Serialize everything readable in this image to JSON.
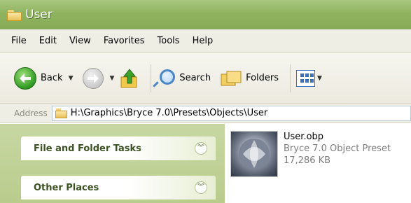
{
  "window": {
    "title": "User"
  },
  "menu": [
    "File",
    "Edit",
    "View",
    "Favorites",
    "Tools",
    "Help"
  ],
  "toolbar": {
    "back_label": "Back",
    "search_label": "Search",
    "folders_label": "Folders"
  },
  "address": {
    "label": "Address",
    "path": "H:\\Graphics\\Bryce 7.0\\Presets\\Objects\\User"
  },
  "left_pane": {
    "panels": [
      "File and Folder Tasks",
      "Other Places"
    ]
  },
  "files": [
    {
      "name": "User.obp",
      "type": "Bryce 7.0 Object Preset",
      "size": "17,286 KB"
    }
  ],
  "colors": {
    "titlebar": "#8fb35f",
    "taskpane": "#c8d7a3",
    "panel_text": "#3b5223",
    "back_button": "#2e9a22"
  }
}
